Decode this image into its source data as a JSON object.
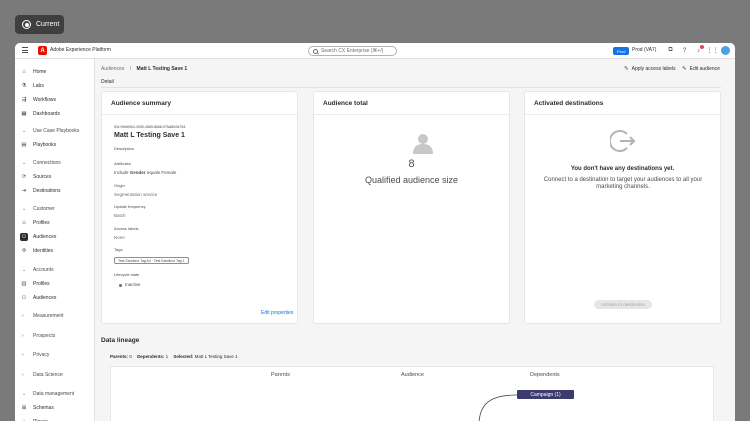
{
  "overlay": {
    "current_label": "Current"
  },
  "topbar": {
    "app_title": "Adobe Experience Platform",
    "search_placeholder": "Search CX Enterprise (⌘+/)",
    "prod_badge": "Prod",
    "sandbox": "Prod (VA7)",
    "icons": [
      "apps-icon",
      "help-icon",
      "bell-icon",
      "grid-icon",
      "avatar"
    ]
  },
  "sidebar": {
    "items": [
      {
        "label": "Home",
        "icon": "home-icon",
        "type": "item"
      },
      {
        "label": "Labs",
        "icon": "labs-icon",
        "type": "item"
      },
      {
        "label": "Workflows",
        "icon": "workflows-icon",
        "type": "item"
      },
      {
        "label": "Dashboards",
        "icon": "dashboards-icon",
        "type": "item"
      },
      {
        "label": "Use Case Playbooks",
        "type": "section"
      },
      {
        "label": "Playbooks",
        "icon": "playbooks-icon",
        "type": "item"
      },
      {
        "label": "Connections",
        "type": "section"
      },
      {
        "label": "Sources",
        "icon": "sources-icon",
        "type": "item"
      },
      {
        "label": "Destinations",
        "icon": "destinations-icon",
        "type": "item"
      },
      {
        "label": "Customer",
        "type": "section"
      },
      {
        "label": "Profiles",
        "icon": "profiles-icon",
        "type": "item"
      },
      {
        "label": "Audiences",
        "icon": "audiences-icon",
        "type": "item",
        "active": true
      },
      {
        "label": "Identities",
        "icon": "identities-icon",
        "type": "item"
      },
      {
        "label": "Accounts",
        "type": "section"
      },
      {
        "label": "Profiles",
        "icon": "account-profiles-icon",
        "type": "item"
      },
      {
        "label": "Audiences",
        "icon": "account-audiences-icon",
        "type": "item"
      },
      {
        "label": "Measurement",
        "type": "collapsed"
      },
      {
        "label": "Prospects",
        "type": "collapsed"
      },
      {
        "label": "Privacy",
        "type": "collapsed"
      },
      {
        "label": "Data Science",
        "type": "collapsed"
      },
      {
        "label": "Data management",
        "type": "section"
      },
      {
        "label": "Schemas",
        "icon": "schemas-icon",
        "type": "item"
      },
      {
        "label": "Places",
        "icon": "places-icon",
        "type": "item"
      }
    ]
  },
  "header": {
    "breadcrumb_parent": "Audiences",
    "breadcrumb_sep": "/",
    "breadcrumb_current": "Matt L Testing Save 1",
    "apply_labels": "Apply access labels",
    "edit_audience": "Edit audience",
    "tab_detail": "Detail"
  },
  "summary": {
    "title": "Audience summary",
    "id": "ID# 99e6f0b2-2690-4565-8668-97fa8603e764",
    "name": "Matt L Testing Save 1",
    "description_label": "Description",
    "attributes_label": "Attributes",
    "attributes_prefix": "Include",
    "attributes_field": "Gender",
    "attributes_suffix": "equals Female",
    "origin_label": "Origin",
    "origin_value": "Segmentation service",
    "frequency_label": "Update frequency",
    "frequency_value": "Batch",
    "access_label": "Access labels",
    "access_value": "None",
    "tags_label": "Tags",
    "tags_value": "Test Sandbox Tag A4 · Test Sandbox Tag 1",
    "lifecycle_label": "Lifecycle state",
    "lifecycle_value": "Inactive",
    "edit_properties": "Edit properties"
  },
  "total": {
    "title": "Audience total",
    "count": "8",
    "label": "Qualified audience size"
  },
  "destinations": {
    "title": "Activated destinations",
    "empty_title": "You don't have any destinations yet.",
    "empty_desc": "Connect to a destination to target your audiences to all your marketing channels.",
    "activate_button": "Activate to destination"
  },
  "lineage": {
    "title": "Data lineage",
    "parents_label": "Parents:",
    "parents_value": "0",
    "dependents_label": "Dependents:",
    "dependents_value": "1",
    "selected_label": "Selected:",
    "selected_value": "Matt L Testing Save 1",
    "col_parents": "Parents",
    "col_audience": "Audience",
    "col_dependents": "Dependents",
    "campaign_node": "Campaign (1)"
  },
  "colors": {
    "accent": "#1473e6",
    "adobe_red": "#eb1000",
    "campaign_node": "#3d3b6e"
  }
}
